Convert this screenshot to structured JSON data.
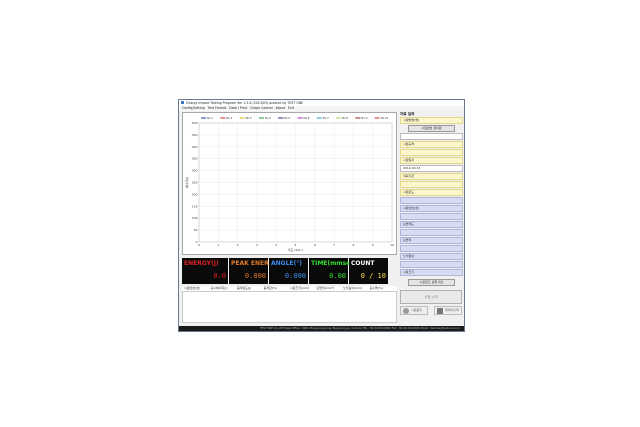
{
  "window": {
    "title": "Charpy Impact Testing Program  Ver 1.5.6 (2014/03) product by TEST ONE",
    "menu": [
      "Config/Setting",
      "Test Format",
      "Data / Print",
      "Graph Control",
      "About",
      "Exit"
    ]
  },
  "chart_data": {
    "type": "line",
    "xlabel": "각도 (Sec.)",
    "ylabel": "에너지(J)",
    "xlim": [
      0,
      10
    ],
    "ylim": [
      0,
      500
    ],
    "xticks": [
      0,
      1,
      2,
      3,
      4,
      5,
      6,
      7,
      8,
      9,
      10
    ],
    "yticks": [
      0,
      50,
      100,
      150,
      200,
      250,
      300,
      350,
      400,
      450,
      500
    ],
    "grid": true,
    "legend_position": "top",
    "series": [
      {
        "name": "No.1",
        "color": "#1f3ea8",
        "values": []
      },
      {
        "name": "No.2",
        "color": "#d62020",
        "values": []
      },
      {
        "name": "No.3",
        "color": "#e0b000",
        "values": []
      },
      {
        "name": "No.4",
        "color": "#2a9a2a",
        "values": []
      },
      {
        "name": "No.5",
        "color": "#1a1a80",
        "values": []
      },
      {
        "name": "No.6",
        "color": "#b020b0",
        "values": []
      },
      {
        "name": "No.7",
        "color": "#1fa0c0",
        "values": []
      },
      {
        "name": "No.8",
        "color": "#a0d060",
        "values": []
      },
      {
        "name": "No.9",
        "color": "#8a2020",
        "values": []
      },
      {
        "name": "No.10",
        "color": "#d03030",
        "values": []
      }
    ]
  },
  "counters": [
    {
      "label": "ENERGY(J)",
      "value": "0.0",
      "label_color": "#e02020",
      "value_color": "#e02020"
    },
    {
      "label": "PEAK ENERGY(J)",
      "value": "0.000",
      "label_color": "#e07a2a",
      "value_color": "#e07a2a"
    },
    {
      "label": "ANGLE(°)",
      "value": "0.000",
      "label_color": "#3a8ef0",
      "value_color": "#3a8ef0"
    },
    {
      "label": "TIME(mmsec)",
      "value": "0.00",
      "label_color": "#30e030",
      "value_color": "#30e030"
    },
    {
      "label": "COUNT",
      "value": "0 / 10",
      "label_color": "#ffffff",
      "value_color": "#ffe040"
    }
  ],
  "result_columns": [
    "시료번호(번)",
    "흡수에너지(J)",
    "충격강도(J)",
    "충격값(%)",
    "시료크기(mm)",
    "단면적(mm²)",
    "노치깊이(mm)",
    "흡수율(%)"
  ],
  "status_text": "TEST ONE CO.,LTD    Head Office : 206-1 Bupyeong-dong, Bupyeong-gu, Incheon    TEL : 82-32-000-0000    FAX : 82-32-000-0001    Email : testone@testone.co.kr",
  "right_panel": {
    "section_title": "자료 입력",
    "fields": [
      {
        "label": "시험방법(명)",
        "style": "yellow"
      },
      {
        "label": "",
        "style": "white"
      },
      {
        "label": "시험규격",
        "style": "yellow"
      },
      {
        "label": "",
        "style": "yellow"
      },
      {
        "label": "시험일자",
        "style": "yellow"
      },
      {
        "label": "2014-03-13",
        "style": "white"
      },
      {
        "label": "의뢰기관",
        "style": "yellow"
      },
      {
        "label": "",
        "style": "yellow"
      },
      {
        "label": "시험온도",
        "style": "yellow"
      },
      {
        "label": "",
        "style": "blue"
      },
      {
        "label": "시료번호(번)",
        "style": "blue"
      },
      {
        "label": "",
        "style": "blue"
      },
      {
        "label": "단면적도",
        "style": "blue"
      },
      {
        "label": "",
        "style": "blue"
      },
      {
        "label": "단면적",
        "style": "blue"
      },
      {
        "label": "",
        "style": "blue"
      },
      {
        "label": "노치형상",
        "style": "blue"
      },
      {
        "label": "",
        "style": "blue"
      },
      {
        "label": "시료크기",
        "style": "blue"
      }
    ],
    "open_button": "시험번호 정의함",
    "test_ready_button": "시료입고 실행 취소",
    "start_button": "시험 시작",
    "stop_button": "시험중지",
    "data_button": "데이터출력"
  },
  "colors": {
    "window_bg": "#f0f0f0",
    "field_yellow": "#fdf6cc",
    "field_blue": "#d8dcf2",
    "counter_bg": "#0a0a0a"
  }
}
